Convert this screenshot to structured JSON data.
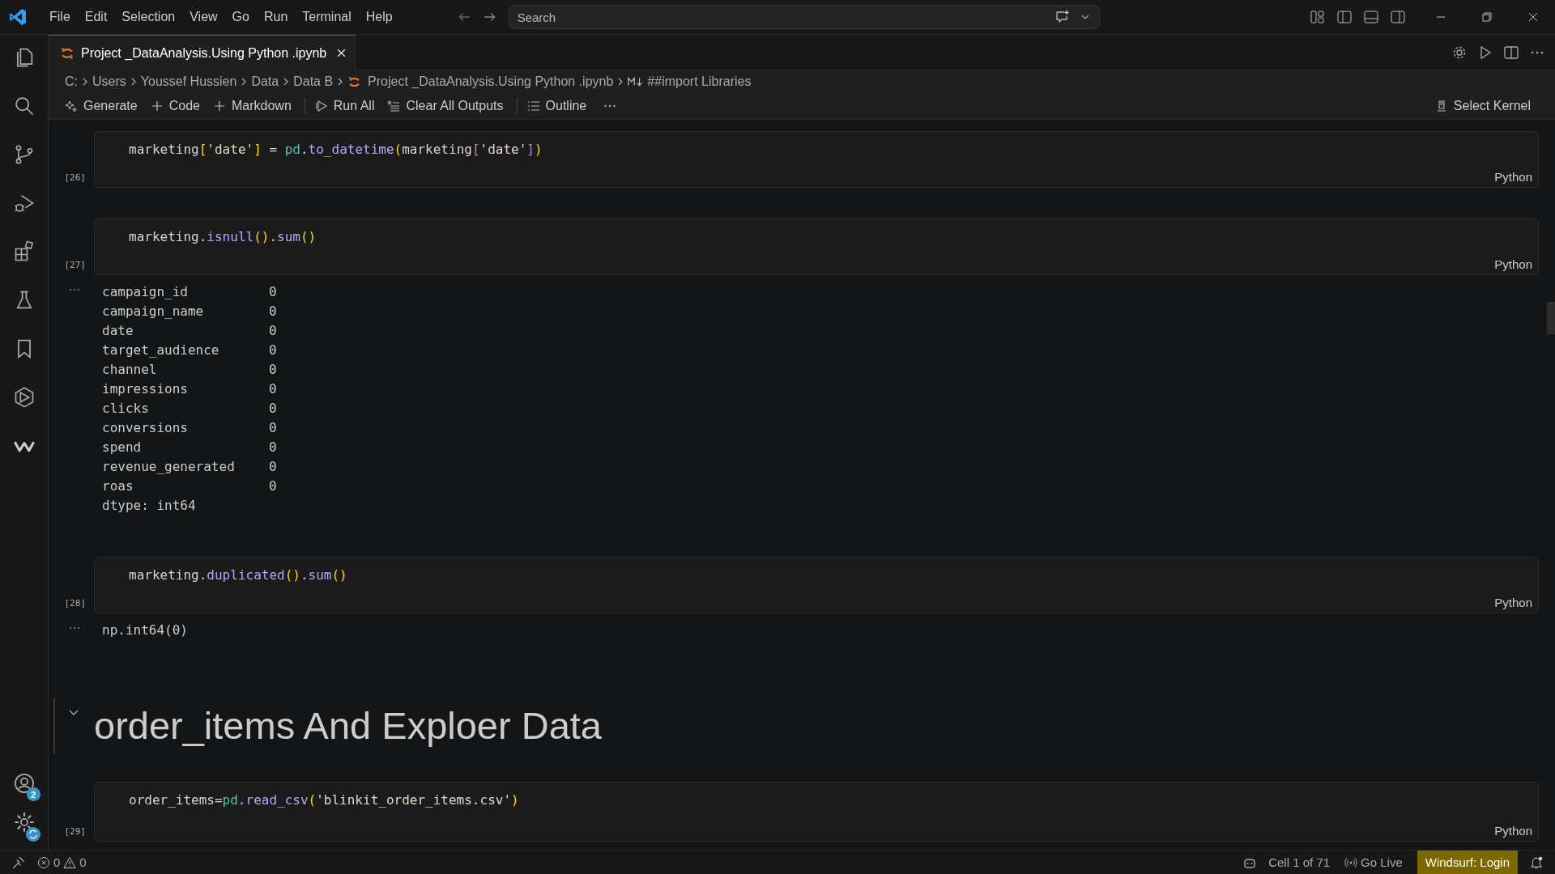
{
  "menu": [
    "File",
    "Edit",
    "Selection",
    "View",
    "Go",
    "Run",
    "Terminal",
    "Help"
  ],
  "search": {
    "placeholder": "Search"
  },
  "activity_badge": "2",
  "tab": {
    "title": "Project _DataAnalysis.Using Python .ipynb",
    "selected": true
  },
  "breadcrumb": [
    {
      "label": "C:",
      "kind": "folder"
    },
    {
      "label": "Users",
      "kind": "folder"
    },
    {
      "label": "Youssef Hussien",
      "kind": "folder"
    },
    {
      "label": "Data",
      "kind": "folder"
    },
    {
      "label": "Data B",
      "kind": "folder"
    },
    {
      "label": "Project _DataAnalysis.Using Python .ipynb",
      "kind": "notebook"
    },
    {
      "label": "##import Libraries",
      "kind": "markdown"
    }
  ],
  "toolbar": [
    {
      "label": "Generate",
      "kind": "sparkle"
    },
    {
      "label": "Code",
      "kind": "plus"
    },
    {
      "label": "Markdown",
      "kind": "plus"
    },
    {
      "label": "Run All",
      "kind": "run"
    },
    {
      "label": "Clear All Outputs",
      "kind": "clear"
    },
    {
      "label": "Outline",
      "kind": "list"
    }
  ],
  "kernel": "Select Kernel",
  "cells": [
    {
      "kind": "code",
      "count": "[26]",
      "language": "Python",
      "code": [
        {
          "t": "marketing",
          "kind": "var"
        },
        {
          "t": "[",
          "kind": "bracket1"
        },
        {
          "t": "'date'",
          "kind": "string"
        },
        {
          "t": "]",
          "kind": "bracket1"
        },
        {
          "t": " = ",
          "kind": "op"
        },
        {
          "t": "pd",
          "kind": "module"
        },
        {
          "t": ".",
          "kind": "op"
        },
        {
          "t": "to_datetime",
          "kind": "func"
        },
        {
          "t": "(",
          "kind": "bracket1"
        },
        {
          "t": "marketing",
          "kind": "var"
        },
        {
          "t": "[",
          "kind": "bracket2"
        },
        {
          "t": "'date'",
          "kind": "string"
        },
        {
          "t": "]",
          "kind": "bracket2"
        },
        {
          "t": ")",
          "kind": "bracket1"
        }
      ]
    },
    {
      "kind": "code",
      "count": "[27]",
      "language": "Python",
      "code": [
        {
          "t": "marketing",
          "kind": "var"
        },
        {
          "t": ".",
          "kind": "op"
        },
        {
          "t": "isnull",
          "kind": "func"
        },
        {
          "t": "()",
          "kind": "bracket1"
        },
        {
          "t": ".",
          "kind": "op"
        },
        {
          "t": "sum",
          "kind": "func"
        },
        {
          "t": "()",
          "kind": "bracket1"
        }
      ],
      "output": {
        "kind": "series",
        "rows": [
          {
            "name": "campaign_id",
            "value": "0"
          },
          {
            "name": "campaign_name",
            "value": "0"
          },
          {
            "name": "date",
            "value": "0"
          },
          {
            "name": "target_audience",
            "value": "0"
          },
          {
            "name": "channel",
            "value": "0"
          },
          {
            "name": "impressions",
            "value": "0"
          },
          {
            "name": "clicks",
            "value": "0"
          },
          {
            "name": "conversions",
            "value": "0"
          },
          {
            "name": "spend",
            "value": "0"
          },
          {
            "name": "revenue_generated",
            "value": "0"
          },
          {
            "name": "roas",
            "value": "0"
          }
        ],
        "footer": "dtype: int64"
      }
    },
    {
      "kind": "code",
      "count": "[28]",
      "language": "Python",
      "code": [
        {
          "t": "marketing",
          "kind": "var"
        },
        {
          "t": ".",
          "kind": "op"
        },
        {
          "t": "duplicated",
          "kind": "func"
        },
        {
          "t": "()",
          "kind": "bracket1"
        },
        {
          "t": ".",
          "kind": "op"
        },
        {
          "t": "sum",
          "kind": "func"
        },
        {
          "t": "()",
          "kind": "bracket1"
        }
      ],
      "output": {
        "kind": "text",
        "text": "np.int64(0)"
      }
    },
    {
      "kind": "heading",
      "text": "order_items And Exploer Data",
      "expanded": true
    },
    {
      "kind": "code",
      "count": "[29]",
      "language": "Python",
      "code": [
        {
          "t": "order_items=",
          "kind": "var"
        },
        {
          "t": "pd",
          "kind": "module"
        },
        {
          "t": ".",
          "kind": "op"
        },
        {
          "t": "read_csv",
          "kind": "func"
        },
        {
          "t": "(",
          "kind": "bracket1"
        },
        {
          "t": "'blinkit_order_items.csv'",
          "kind": "string"
        },
        {
          "t": ")",
          "kind": "bracket1"
        }
      ]
    }
  ],
  "status_bar": {
    "errors": "0",
    "warnings": "0",
    "cell": "Cell 1 of 71",
    "go_live": "Go Live",
    "login": "Windsurf: Login"
  }
}
